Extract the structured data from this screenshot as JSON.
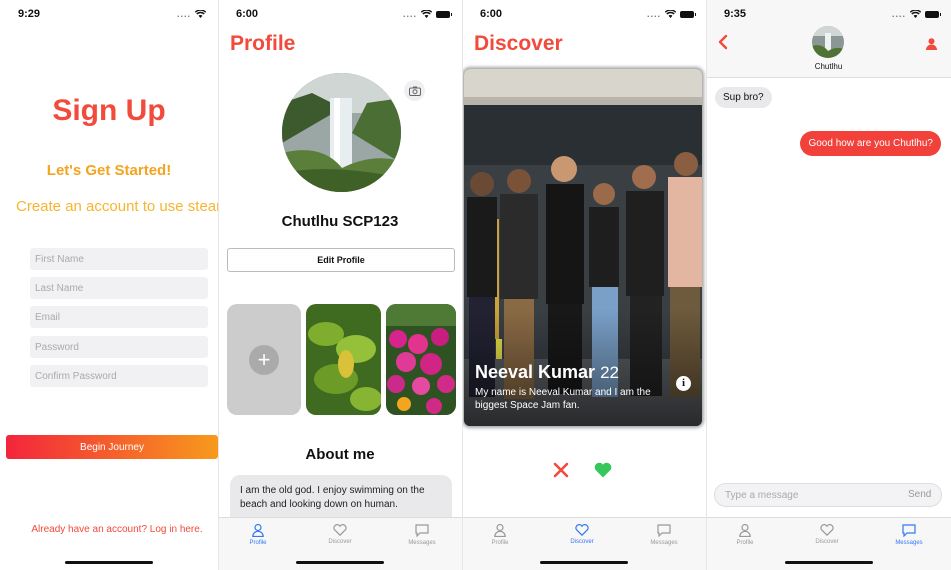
{
  "signup": {
    "status_time": "9:29",
    "title": "Sign Up",
    "subtitle": "Let's Get Started!",
    "description": "Create an account to use steamy",
    "fields": [
      {
        "placeholder": "First Name"
      },
      {
        "placeholder": "Last Name"
      },
      {
        "placeholder": "Email"
      },
      {
        "placeholder": "Password"
      },
      {
        "placeholder": "Confirm Password"
      }
    ],
    "begin_label": "Begin Journey",
    "login_link": "Already have an account? Log in here."
  },
  "profile": {
    "status_time": "6:00",
    "title": "Profile",
    "name": "Chutlhu SCP123",
    "edit_label": "Edit Profile",
    "add_icon": "+",
    "about_heading": "About me",
    "bio": "I am the old god. I enjoy swimming on the beach and looking down on human."
  },
  "discover": {
    "status_time": "6:00",
    "title": "Discover",
    "card": {
      "name": "Neeval Kumar",
      "age": "22",
      "description": "My name is Neeval Kumar and I am the biggest Space Jam fan."
    },
    "info_icon": "i"
  },
  "chat": {
    "status_time": "9:35",
    "contact_name": "Chutlhu",
    "messages": [
      {
        "from": "them",
        "text": "Sup bro?"
      },
      {
        "from": "me",
        "text": "Good how are you Chutlhu?"
      }
    ],
    "input_placeholder": "Type a message",
    "send_label": "Send"
  },
  "tabs": [
    {
      "label": "Profile",
      "icon": "person-icon"
    },
    {
      "label": "Discover",
      "icon": "heart-icon"
    },
    {
      "label": "Messages",
      "icon": "message-icon"
    }
  ],
  "colors": {
    "brand_red": "#f24a3b",
    "accent_orange": "#f4a41e",
    "active_tab": "#3478f6",
    "like_green": "#34c759"
  }
}
